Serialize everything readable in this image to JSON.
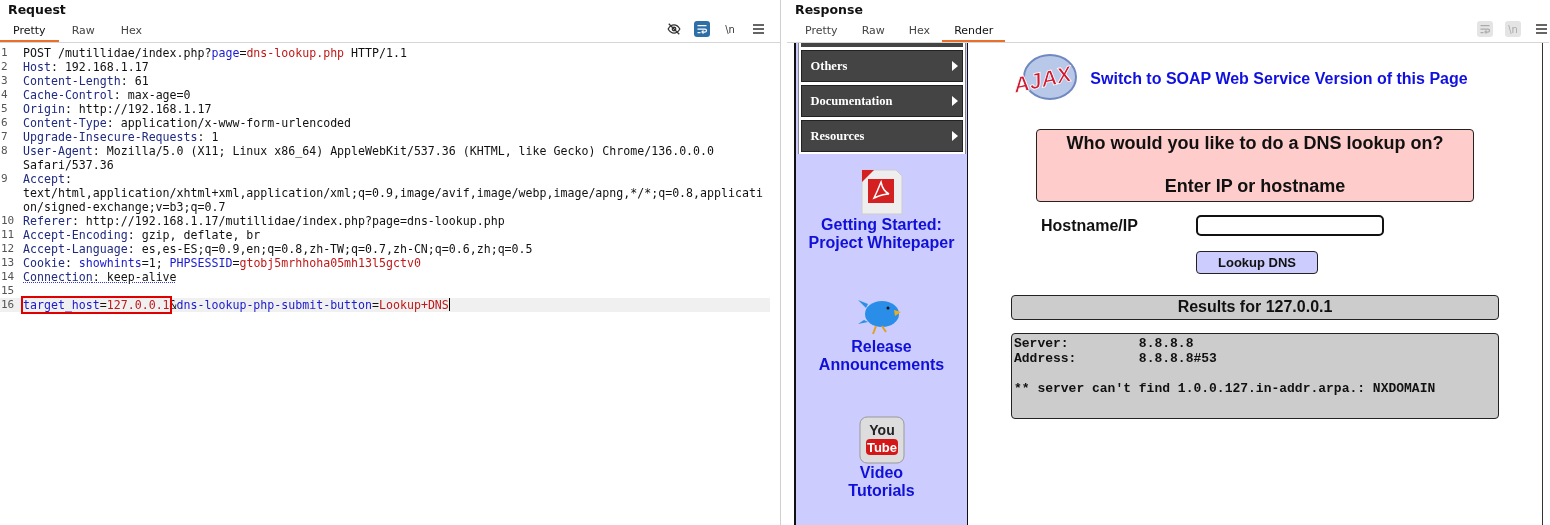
{
  "request": {
    "title": "Request",
    "tabs": [
      {
        "label": "Pretty",
        "selected": true
      },
      {
        "label": "Raw",
        "selected": false
      },
      {
        "label": "Hex",
        "selected": false
      }
    ],
    "toolbar": [
      {
        "kind": "eye-off",
        "on": false
      },
      {
        "kind": "wrap",
        "on": true
      },
      {
        "kind": "newline",
        "label": "\\n",
        "on": false
      },
      {
        "kind": "menu",
        "on": false
      }
    ],
    "lines": [
      {
        "number": "1",
        "segments": [
          {
            "text": "POST /mutillidae/index.php?",
            "kind": "plain"
          },
          {
            "text": "page",
            "kind": "param"
          },
          {
            "text": "=",
            "kind": "plain"
          },
          {
            "text": "dns-lookup.php",
            "kind": "value"
          },
          {
            "text": " HTTP/1.1",
            "kind": "plain"
          }
        ]
      },
      {
        "number": "2",
        "segments": [
          {
            "text": "Host",
            "kind": "name"
          },
          {
            "text": ": 192.168.1.17",
            "kind": "plain"
          }
        ]
      },
      {
        "number": "3",
        "segments": [
          {
            "text": "Content-Length",
            "kind": "name"
          },
          {
            "text": ": 61",
            "kind": "plain"
          }
        ]
      },
      {
        "number": "4",
        "segments": [
          {
            "text": "Cache-Control",
            "kind": "name"
          },
          {
            "text": ": max-age=0",
            "kind": "plain"
          }
        ]
      },
      {
        "number": "5",
        "segments": [
          {
            "text": "Origin",
            "kind": "name"
          },
          {
            "text": ": http://192.168.1.17",
            "kind": "plain"
          }
        ]
      },
      {
        "number": "6",
        "segments": [
          {
            "text": "Content-Type",
            "kind": "name"
          },
          {
            "text": ": application/x-www-form-urlencoded",
            "kind": "plain"
          }
        ]
      },
      {
        "number": "7",
        "segments": [
          {
            "text": "Upgrade-Insecure-Requests",
            "kind": "name"
          },
          {
            "text": ": 1",
            "kind": "plain"
          }
        ]
      },
      {
        "number": "8",
        "segments": [
          {
            "text": "User-Agent",
            "kind": "name"
          },
          {
            "text": ": Mozilla/5.0 (X11; Linux x86_64) AppleWebKit/537.36 (KHTML, like Gecko) Chrome/136.0.0.0 Safari/537.36",
            "kind": "plain"
          }
        ]
      },
      {
        "number": "9",
        "segments": [
          {
            "text": "Accept",
            "kind": "name"
          },
          {
            "text": ": text/html,application/xhtml+xml,application/xml;q=0.9,image/avif,image/webp,image/apng,*/*;q=0.8,application/signed-exchange;v=b3;q=0.7",
            "kind": "plain"
          }
        ]
      },
      {
        "number": "10",
        "segments": [
          {
            "text": "Referer",
            "kind": "name"
          },
          {
            "text": ": http://192.168.1.17/mutillidae/index.php?page=dns-lookup.php",
            "kind": "plain"
          }
        ]
      },
      {
        "number": "11",
        "segments": [
          {
            "text": "Accept-Encoding",
            "kind": "name"
          },
          {
            "text": ": gzip, deflate, br",
            "kind": "plain"
          }
        ]
      },
      {
        "number": "12",
        "segments": [
          {
            "text": "Accept-Language",
            "kind": "name"
          },
          {
            "text": ": es,es-ES;q=0.9,en;q=0.8,zh-TW;q=0.7,zh-CN;q=0.6,zh;q=0.5",
            "kind": "plain"
          }
        ]
      },
      {
        "number": "13",
        "segments": [
          {
            "text": "Cookie",
            "kind": "name"
          },
          {
            "text": ": ",
            "kind": "plain"
          },
          {
            "text": "showhints",
            "kind": "param"
          },
          {
            "text": "=1; ",
            "kind": "plain"
          },
          {
            "text": "PHPSESSID",
            "kind": "param"
          },
          {
            "text": "=",
            "kind": "plain"
          },
          {
            "text": "gtobj5mrhhoha05mh13l5gctv0",
            "kind": "value"
          }
        ]
      },
      {
        "number": "14",
        "underlined": true,
        "segments": [
          {
            "text": "Connection",
            "kind": "name"
          },
          {
            "text": ": keep-alive",
            "kind": "plain"
          }
        ]
      },
      {
        "number": "15"
      },
      {
        "number": "16",
        "current": true,
        "boxed": [
          {
            "text": "target_host",
            "kind": "param"
          },
          {
            "text": "=",
            "kind": "plain"
          },
          {
            "text": "127.0.0.1",
            "kind": "value"
          }
        ],
        "segments": [
          {
            "text": "&",
            "kind": "plain"
          },
          {
            "text": "dns-lookup-php-submit-button",
            "kind": "param"
          },
          {
            "text": "=",
            "kind": "plain"
          },
          {
            "text": "Lookup+DNS",
            "kind": "value"
          }
        ]
      }
    ]
  },
  "response": {
    "title": "Response",
    "tabs": [
      {
        "label": "Pretty",
        "selected": false
      },
      {
        "label": "Raw",
        "selected": false
      },
      {
        "label": "Hex",
        "selected": false
      },
      {
        "label": "Render",
        "selected": true
      }
    ],
    "toolbar": [
      {
        "kind": "wrap",
        "disabled": true
      },
      {
        "kind": "newline",
        "label": "\\n",
        "disabled": true
      },
      {
        "kind": "menu",
        "disabled": false
      }
    ],
    "render": {
      "menu": [
        {
          "label": "Others"
        },
        {
          "label": "Documentation"
        },
        {
          "label": "Resources"
        }
      ],
      "links": [
        {
          "kind": "pdf",
          "lines": [
            "Getting Started:",
            "Project Whitepaper"
          ]
        },
        {
          "kind": "bird",
          "lines": [
            "Release",
            "Announcements"
          ]
        },
        {
          "kind": "video",
          "lines": [
            "Video",
            "Tutorials"
          ],
          "logo": [
            "You",
            "Tube"
          ]
        }
      ],
      "ajax_logo": "AJAX",
      "soap_link": "Switch to SOAP Web Service Version of this Page",
      "prompt": {
        "question": "Who would you like to do a DNS lookup on?",
        "hint": "Enter IP or hostname"
      },
      "field_label": "Hostname/IP",
      "button": "Lookup DNS",
      "results_title": "Results for 127.0.0.1",
      "results": "Server:\t\t8.8.8.8\nAddress:\t8.8.8.8#53\n\n** server can't find 1.0.0.127.in-addr.arpa.: NXDOMAIN"
    }
  }
}
